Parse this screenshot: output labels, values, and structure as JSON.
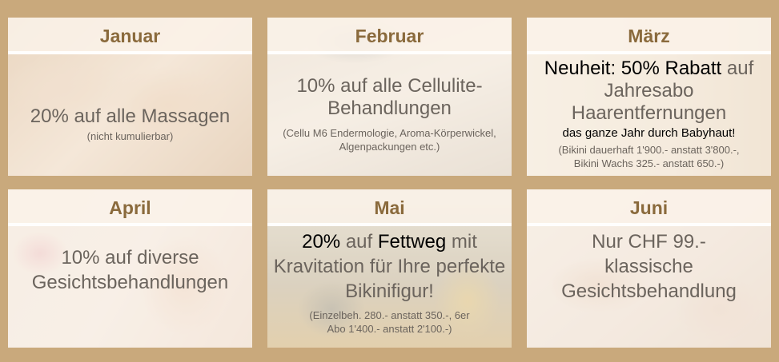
{
  "cards": [
    {
      "month": "Januar",
      "offer": "20% auf alle Massagen",
      "note": "(nicht kumulierbar)"
    },
    {
      "month": "Februar",
      "offer": "10% auf alle Cellulite-Behandlungen",
      "note": "(Cellu M6 Endermologie, Aroma-Körperwickel, Algenpackungen etc.)"
    },
    {
      "month": "März",
      "offer_highlight": "Neuheit: 50% Rabatt",
      "offer_rest": "auf Jahresabo Haarentfernungen",
      "tagline": "das ganze Jahr durch Babyhaut!",
      "note": "(Bikini dauerhaft 1'900.- anstatt 3'800.-, Bikini Wachs 325.- anstatt 650.-)"
    },
    {
      "month": "April",
      "offer": "10% auf diverse Gesichtsbehandlungen"
    },
    {
      "month": "Mai",
      "offer_p1": "20%",
      "offer_p2": "auf",
      "offer_p3": "Fettweg",
      "offer_p4": "mit Kravitation für Ihre perfekte Bikinifigur!",
      "note": "(Einzelbeh. 280.- anstatt 350.-, 6er Abo 1'400.- anstatt 2'100.-)"
    },
    {
      "month": "Juni",
      "offer": "Nur CHF 99.- klassische Gesichtsbehandlung"
    }
  ]
}
